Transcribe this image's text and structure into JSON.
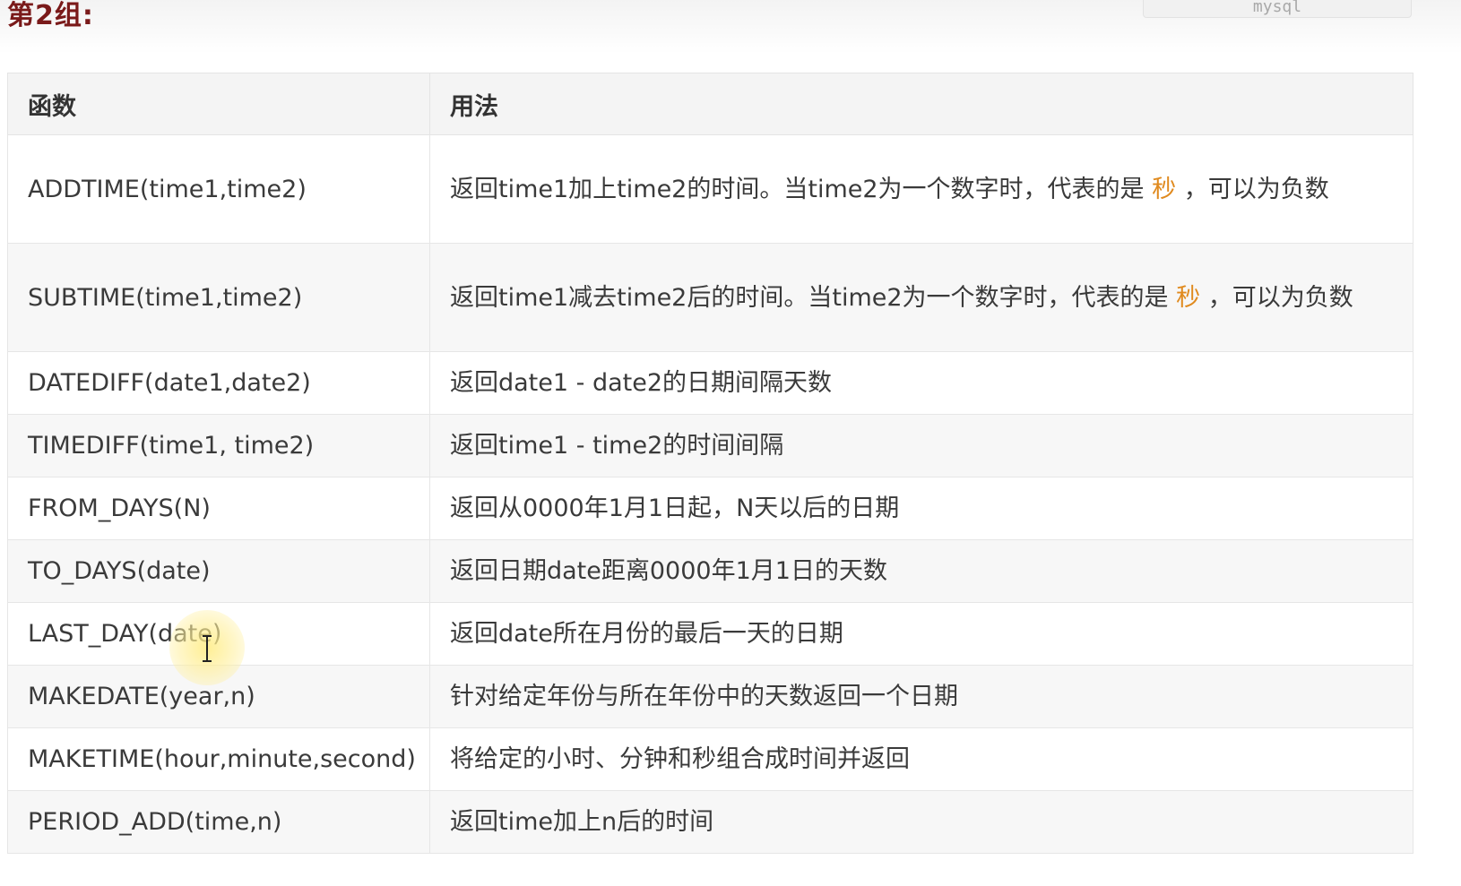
{
  "heading": {
    "group_title": "第2组:"
  },
  "code_tab": {
    "language_label": "mysql"
  },
  "table": {
    "headers": {
      "function": "函数",
      "usage": "用法"
    },
    "rows": [
      {
        "function": "ADDTIME(time1,time2)",
        "usage_before": "返回time1加上time2的时间。当time2为一个数字时，代表的是 ",
        "usage_highlight": "秒",
        "usage_after": " ，可以为负数"
      },
      {
        "function": "SUBTIME(time1,time2)",
        "usage_before": "返回time1减去time2后的时间。当time2为一个数字时，代表的是 ",
        "usage_highlight": "秒",
        "usage_after": " ，可以为负数"
      },
      {
        "function": "DATEDIFF(date1,date2)",
        "usage": "返回date1 - date2的日期间隔天数"
      },
      {
        "function": "TIMEDIFF(time1, time2)",
        "usage": "返回time1 - time2的时间间隔"
      },
      {
        "function": "FROM_DAYS(N)",
        "usage": "返回从0000年1月1日起，N天以后的日期"
      },
      {
        "function": "TO_DAYS(date)",
        "usage": "返回日期date距离0000年1月1日的天数"
      },
      {
        "function": "LAST_DAY(date)",
        "usage": "返回date所在月份的最后一天的日期"
      },
      {
        "function": "MAKEDATE(year,n)",
        "usage": "针对给定年份与所在年份中的天数返回一个日期"
      },
      {
        "function": "MAKETIME(hour,minute,second)",
        "usage": "将给定的小时、分钟和秒组合成时间并返回"
      },
      {
        "function": "PERIOD_ADD(time,n)",
        "usage": "返回time加上n后的时间"
      }
    ]
  },
  "colors": {
    "group_title": "#7a1a1a",
    "highlight": "#e08a1e",
    "header_bg": "#f4f4f4",
    "border": "#e6e6e6"
  }
}
